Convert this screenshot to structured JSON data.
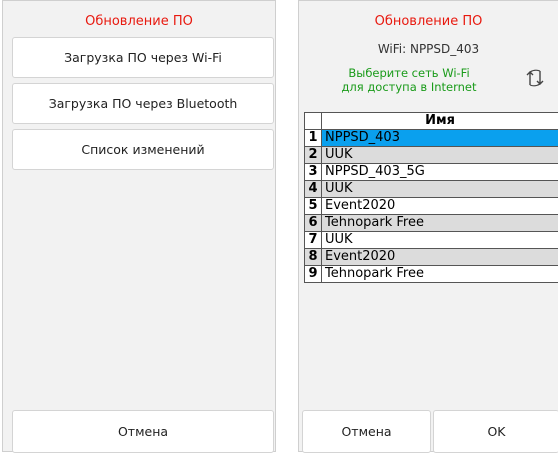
{
  "left_screen": {
    "title": "Обновление ПО",
    "menu": [
      {
        "label": "Загрузка ПО через Wi-Fi"
      },
      {
        "label": "Загрузка ПО через Bluetooth"
      },
      {
        "label": "Список изменений"
      }
    ],
    "cancel_label": "Отмена"
  },
  "right_screen": {
    "title": "Обновление ПО",
    "wifi_status": "WiFi: NPPSD_403",
    "hint_line1": "Выберите сеть Wi-Fi",
    "hint_line2": "для доступа в Internet",
    "refresh_icon": "refresh-icon",
    "table": {
      "header": "Имя",
      "rows": [
        {
          "num": "1",
          "name": "NPPSD_403",
          "selected": true
        },
        {
          "num": "2",
          "name": "UUK"
        },
        {
          "num": "3",
          "name": "NPPSD_403_5G"
        },
        {
          "num": "4",
          "name": "UUK"
        },
        {
          "num": "5",
          "name": "Event2020"
        },
        {
          "num": "6",
          "name": "Tehnopark Free"
        },
        {
          "num": "7",
          "name": "UUK"
        },
        {
          "num": "8",
          "name": "Event2020"
        },
        {
          "num": "9",
          "name": "Tehnopark Free"
        }
      ]
    },
    "cancel_label": "Отмена",
    "ok_label": "OK"
  },
  "colors": {
    "title": "#e8190f",
    "hint": "#1a9b1a",
    "selected_row": "#0aa0ee",
    "alt_row": "#dcdcdc"
  }
}
